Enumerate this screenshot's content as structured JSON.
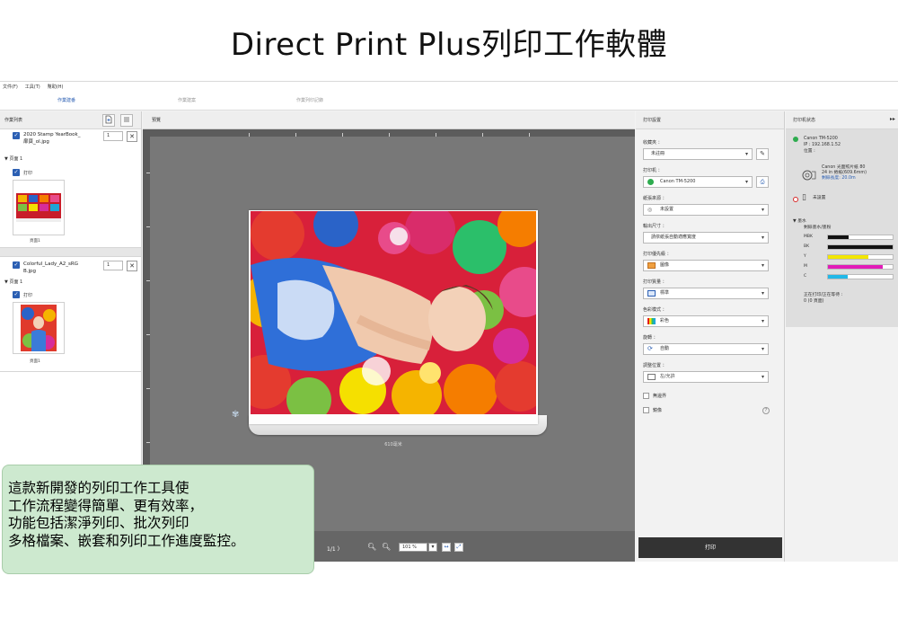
{
  "hero": {
    "title": "Direct Print Plus列印工作軟體"
  },
  "menu": [
    "文件(F)",
    "工具(T)",
    "幫助(H)"
  ],
  "tabs": [
    {
      "label": "作業建番",
      "active": true
    },
    {
      "label": "作業建案",
      "active": false
    },
    {
      "label": "作業列印記錄",
      "active": false
    }
  ],
  "job_panel": {
    "title": "作業列表",
    "jobs": [
      {
        "name": "2020 Stamp YearBook_\n扉頁_ol.jpg",
        "copies": "1",
        "tree_label": "頁面 1",
        "print_label": "打印",
        "page_label": "頁面1"
      },
      {
        "name": "Colorful_Lady_A2_sRG\nB.jpg",
        "copies": "1",
        "tree_label": "頁面 1",
        "print_label": "打印",
        "page_label": "頁面1"
      }
    ]
  },
  "preview": {
    "title": "預覽",
    "roll_label": "610毫米",
    "pager": "1/1",
    "zoom": "101 %"
  },
  "settings": {
    "title": "打印設置",
    "fields": [
      {
        "label": "收藏夾 ：",
        "value": "未註冊"
      },
      {
        "label": "打印机 ：",
        "value": "Canon TM-5200"
      },
      {
        "label": "紙張來源 ：",
        "value": "未設置"
      },
      {
        "label": "輸出尺寸 ：",
        "value": "請依紙張自動適應寬度"
      },
      {
        "label": "打印優先級 ：",
        "value": "圖像"
      },
      {
        "label": "打印質量 ：",
        "value": "標準"
      },
      {
        "label": "色彩模式 ：",
        "value": "彩色"
      },
      {
        "label": "旋轉 ：",
        "value": "自動"
      },
      {
        "label": "調整位置 ：",
        "value": "左/允許"
      }
    ],
    "checkboxes": [
      "無邊界",
      "鏡像"
    ],
    "print_button": "打印"
  },
  "printer_status": {
    "title": "打印机状态",
    "arrows": "▸▸",
    "printer_name": "Canon TM-5200",
    "ip": "IP : 192.168.1.52",
    "location": "位置 :",
    "roll_info": [
      "Canon 光面照片紙 80",
      "24 in 捲紙(609.6mm)",
      "剩餘長度: 20.0m"
    ],
    "tray_value": "未設置",
    "ink_title": "墨水",
    "ink_subtitle": "剩餘墨水/墨粉",
    "inks": [
      {
        "name": "MBK",
        "level": 0.32,
        "color": "#111111"
      },
      {
        "name": "BK",
        "level": 1.0,
        "color": "#111111"
      },
      {
        "name": "Y",
        "level": 0.62,
        "color": "#f2e600"
      },
      {
        "name": "M",
        "level": 0.85,
        "color": "#e21bb8"
      },
      {
        "name": "C",
        "level": 0.3,
        "color": "#22b8e8"
      }
    ],
    "queue_label": "正在打印/正在等待 :",
    "queue_value": "0 (0 頁面)"
  },
  "caption": {
    "lines": [
      "這款新開發的列印工作工具使",
      "工作流程變得簡單、更有效率，",
      "功能包括潔淨列印、批次列印",
      "多格檔案、嵌套和列印工作進度監控。"
    ]
  },
  "colors": {
    "accent": "#2b5fb3",
    "status_green": "#2eac4f",
    "caption_bg": "#cde9cf"
  }
}
